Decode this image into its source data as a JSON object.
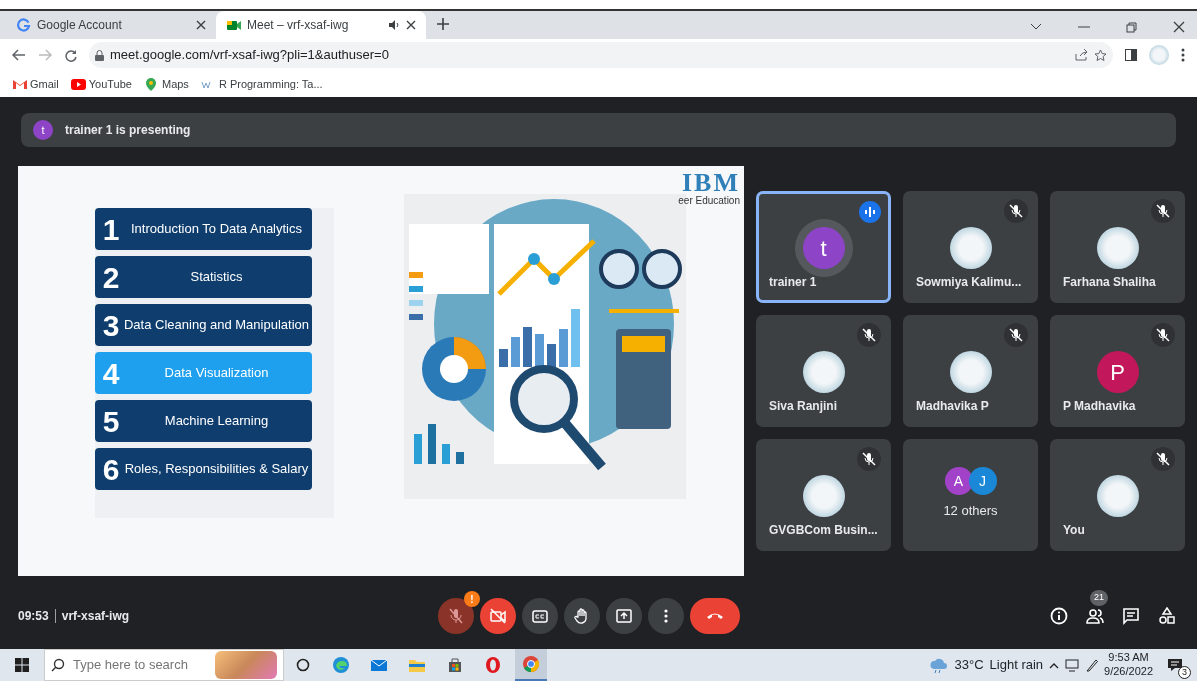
{
  "browser": {
    "tabs": [
      {
        "title": "Google Account",
        "kind": "google",
        "selected": false,
        "audio": false
      },
      {
        "title": "Meet – vrf-xsaf-iwg",
        "kind": "meet",
        "selected": true,
        "audio": true
      }
    ],
    "url": "meet.google.com/vrf-xsaf-iwg?pli=1&authuser=0",
    "bookmarks": [
      {
        "label": "Gmail",
        "kind": "gmail"
      },
      {
        "label": "YouTube",
        "kind": "youtube"
      },
      {
        "label": "Maps",
        "kind": "maps"
      },
      {
        "label": "R Programming: Ta...",
        "kind": "w3"
      }
    ]
  },
  "meeting": {
    "presenter_initial": "t",
    "presenting_text": "trainer 1 is presenting",
    "slide": {
      "logo": "IBM",
      "logo_caption": "eer Education",
      "items": [
        {
          "number": "1",
          "label": "Introduction To Data Analytics",
          "highlighted": false
        },
        {
          "number": "2",
          "label": "Statistics",
          "highlighted": false
        },
        {
          "number": "3",
          "label": "Data Cleaning and Manipulation",
          "highlighted": false
        },
        {
          "number": "4",
          "label": "Data Visualization",
          "highlighted": true
        },
        {
          "number": "5",
          "label": "Machine Learning",
          "highlighted": false
        },
        {
          "number": "6",
          "label": "Roles, Responsibilities & Salary",
          "highlighted": false
        }
      ]
    },
    "participants": [
      {
        "kind": "letter",
        "name": "trainer 1",
        "initial": "t",
        "color": "#8e44c7",
        "speaking": true,
        "muted": false
      },
      {
        "kind": "photo",
        "name": "Sowmiya Kalimu...",
        "speaking": false,
        "muted": true
      },
      {
        "kind": "photo",
        "name": "Farhana Shaliha",
        "speaking": false,
        "muted": true
      },
      {
        "kind": "photo",
        "name": "Siva Ranjini",
        "speaking": false,
        "muted": true
      },
      {
        "kind": "photo",
        "name": "Madhavika P",
        "speaking": false,
        "muted": true
      },
      {
        "kind": "letter",
        "name": "P Madhavika",
        "initial": "P",
        "color": "#c2185b",
        "speaking": false,
        "muted": true
      },
      {
        "kind": "photo",
        "name": "GVGBCom Busin...",
        "speaking": false,
        "muted": true
      },
      {
        "kind": "others",
        "label": "12 others",
        "initials": [
          {
            "letter": "A",
            "color": "#a142c9"
          },
          {
            "letter": "J",
            "color": "#1a88d6"
          }
        ]
      },
      {
        "kind": "photo",
        "name": "You",
        "speaking": false,
        "muted": true
      }
    ],
    "time": "09:53",
    "code": "vrf-xsaf-iwg",
    "controls": [
      {
        "kind": "mic",
        "off": true,
        "alert": "!"
      },
      {
        "kind": "camera",
        "off": true
      },
      {
        "kind": "captions",
        "off": false
      },
      {
        "kind": "hand",
        "off": false
      },
      {
        "kind": "present",
        "off": false
      },
      {
        "kind": "more",
        "off": false
      },
      {
        "kind": "end"
      }
    ],
    "side_controls": [
      {
        "kind": "info"
      },
      {
        "kind": "people",
        "badge": "21"
      },
      {
        "kind": "chat"
      },
      {
        "kind": "activities"
      }
    ]
  },
  "taskbar": {
    "search_placeholder": "Type here to search",
    "apps": [
      {
        "kind": "cortana",
        "selected": false
      },
      {
        "kind": "edge",
        "selected": false
      },
      {
        "kind": "mail",
        "selected": false
      },
      {
        "kind": "explorer",
        "selected": false
      },
      {
        "kind": "store",
        "selected": false
      },
      {
        "kind": "opera",
        "selected": false
      },
      {
        "kind": "chrome",
        "selected": true
      }
    ],
    "temperature": "33°C",
    "weather": "Light rain",
    "time": "9:53 AM",
    "date": "9/26/2022",
    "notifications": "3"
  }
}
